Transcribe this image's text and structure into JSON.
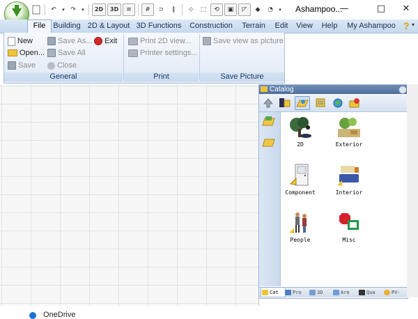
{
  "window": {
    "title": "Ashampoo...",
    "controls": [
      "—",
      "□",
      "✕"
    ]
  },
  "quick_access": [
    "doc",
    "undo",
    "▾",
    "redo",
    "▾",
    "2D",
    "3D",
    "walls",
    "grid",
    "snap",
    "meas",
    "axis",
    "sel",
    "rot",
    "pic",
    "roof",
    "fill",
    "▾"
  ],
  "ribbon_tabs": [
    "File",
    "Building",
    "2D & Layout",
    "3D Functions",
    "Construction",
    "Terrain",
    "Edit",
    "View",
    "Help",
    "My Ashampoo"
  ],
  "active_tab": "File",
  "groups": {
    "general": {
      "label": "General",
      "new": "New",
      "open": "Open...",
      "save": "Save",
      "save_as": "Save As...",
      "save_all": "Save All",
      "close": "Close",
      "exit": "Exit"
    },
    "print": {
      "label": "Print",
      "print_2d": "Print 2D view...",
      "printer_settings": "Printer settings..."
    },
    "save_picture": {
      "label": "Save Picture",
      "save_view": "Save view as picture"
    }
  },
  "catalog": {
    "title": "Catalog",
    "items": [
      {
        "label": "2D",
        "icon": "tree-icon"
      },
      {
        "label": "Exterior",
        "icon": "garden-icon"
      },
      {
        "label": "Component",
        "icon": "door-icon"
      },
      {
        "label": "Interior",
        "icon": "sofa-icon"
      },
      {
        "label": "People",
        "icon": "people-icon"
      },
      {
        "label": "Misc",
        "icon": "sign-icon"
      }
    ],
    "bottom_tabs": [
      "Cat",
      "Pro",
      "3D",
      "Are",
      "Qua",
      "PV-"
    ]
  },
  "taskbar": {
    "onedrive": "OneDrive"
  },
  "colors": {
    "ribbon_bg": "#e1eaf5",
    "tab_row": "#c6d9ee",
    "catalog_header": "#4e6f9c",
    "grid": "#e2e2e2"
  }
}
